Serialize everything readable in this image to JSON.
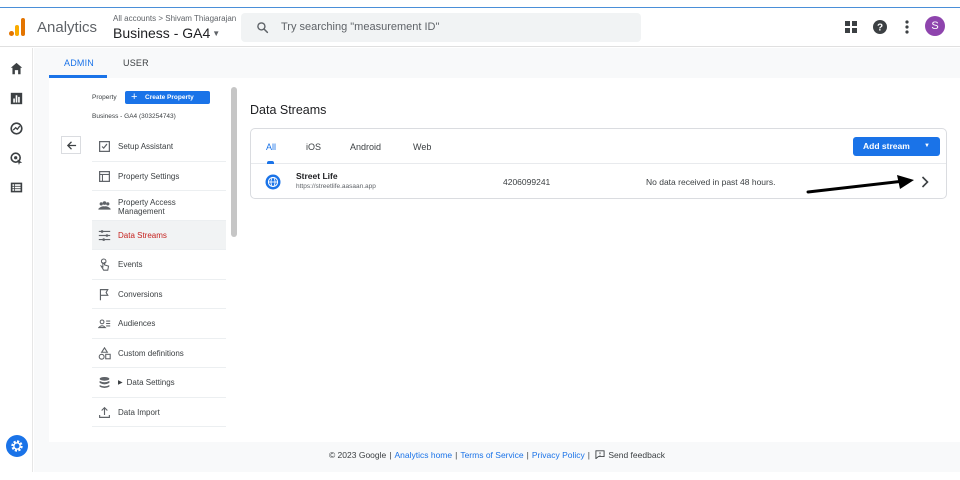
{
  "header": {
    "app_name": "Analytics",
    "account_crumb": "All accounts > Shivam Thiagarajan",
    "property_name": "Business - GA4",
    "search_placeholder": "Try searching \"measurement ID\"",
    "avatar_initial": "S",
    "icons": [
      "apps-grid-icon",
      "help-icon",
      "more-vert-icon"
    ]
  },
  "rail": {
    "icons": [
      "home-icon",
      "reports-icon",
      "explore-icon",
      "advertising-icon",
      "configure-icon",
      "settings-icon"
    ]
  },
  "tabs": [
    {
      "label": "ADMIN",
      "active": true
    },
    {
      "label": "USER",
      "active": false
    }
  ],
  "property": {
    "label": "Property",
    "create_label": "Create Property",
    "name": "Business - GA4 (303254743)"
  },
  "menu": [
    {
      "label": "Setup Assistant",
      "icon": "checklist-icon"
    },
    {
      "label": "Property Settings",
      "icon": "property-settings-icon"
    },
    {
      "label": "Property Access\nManagement",
      "icon": "people-icon"
    },
    {
      "label": "Data Streams",
      "icon": "data-streams-icon",
      "active": true
    },
    {
      "label": "Events",
      "icon": "touch-icon"
    },
    {
      "label": "Conversions",
      "icon": "flag-icon"
    },
    {
      "label": "Audiences",
      "icon": "audiences-icon"
    },
    {
      "label": "Custom definitions",
      "icon": "shapes-icon"
    },
    {
      "label": "Data Settings",
      "icon": "database-icon",
      "expandable": true
    },
    {
      "label": "Data Import",
      "icon": "upload-icon"
    }
  ],
  "data_streams": {
    "title": "Data Streams",
    "tabs": [
      "All",
      "iOS",
      "Android",
      "Web"
    ],
    "active_tab": "All",
    "add_stream_label": "Add stream",
    "streams": [
      {
        "name": "Street Life",
        "url": "https://streetlife.aasaan.app",
        "id": "4206099241",
        "status": "No data received in past 48 hours."
      }
    ]
  },
  "footer": {
    "copyright": "© 2023 Google",
    "links": [
      "Analytics home",
      "Terms of Service",
      "Privacy Policy"
    ],
    "feedback": "Send feedback"
  },
  "colors": {
    "accent": "#1a73e8",
    "active_menu_text": "#c5221f",
    "avatar": "#8e44ad"
  }
}
